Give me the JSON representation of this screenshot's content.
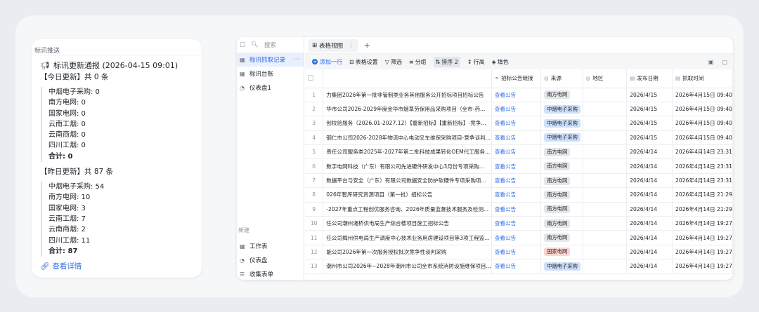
{
  "notify": {
    "header": "标讯推送",
    "title": "标讯更新通报 (2026-04-15 09:01)",
    "today_heading": "【今日更新】共 0 条",
    "today_lines": [
      "中烟电子采购: 0",
      "南方电网: 0",
      "国家电网: 0",
      "云南工烟: 0",
      "云南商烟: 0",
      "四川工烟: 0"
    ],
    "today_total": "合计: 0",
    "yesterday_heading": "【昨日更新】共 87 条",
    "yesterday_lines": [
      "中烟电子采购: 54",
      "南方电网: 10",
      "国家电网: 3",
      "云南工烟: 7",
      "云南商烟: 2",
      "四川工烟: 11"
    ],
    "yesterday_total": "合计: 87",
    "link_label": "查看详情",
    "link_color": "#2e6be6"
  },
  "app": {
    "search_label": "搜索",
    "sidebar_items": [
      {
        "label": "标讯抓取记录",
        "active": true
      },
      {
        "label": "标讯台账",
        "active": false
      },
      {
        "label": "仪表盘1",
        "active": false
      }
    ],
    "new_label": "新建",
    "new_items": [
      "工作表",
      "仪表盘",
      "收集表单"
    ],
    "view_tab": "表格视图",
    "toolbar": {
      "add_row": "添加一行",
      "table_settings": "表格设置",
      "filter": "筛选",
      "group": "分组",
      "sort": "排序 2",
      "row_height": "行高",
      "fill_color": "填色"
    },
    "columns": [
      "",
      "招标公告链接",
      "来源",
      "地区",
      "发布日期",
      "抓取时间"
    ],
    "rows": [
      {
        "n": "1",
        "title": "力集团2026年第一批非管制类业务其他服务公开招标项目招标公告",
        "link": "查看公告",
        "source": "南方电网",
        "tag": "gray",
        "date": "2026/4/15",
        "fetched": "2026年4月15日 09:40"
      },
      {
        "n": "2",
        "title": "华市公司2026-2029年度金华市烟草劳保用品采购项目（全市-药...",
        "link": "查看公告",
        "source": "中烟电子采购",
        "tag": "blue",
        "date": "2026/4/15",
        "fetched": "2026年4月15日 09:40"
      },
      {
        "n": "3",
        "title": "创校验服务（2026.01-2027.12）【重新招标】【重新招标】-竞争...",
        "link": "查看公告",
        "source": "中烟电子采购",
        "tag": "blue",
        "date": "2026/4/15",
        "fetched": "2026年4月15日 09:40"
      },
      {
        "n": "4",
        "title": "钢仁市公司2026-2028年物流中心电动叉车维保采购项目-竞争谈判...",
        "link": "查看公告",
        "source": "中烟电子采购",
        "tag": "blue",
        "date": "2026/4/15",
        "fetched": "2026年4月15日 09:40"
      },
      {
        "n": "5",
        "title": "责任公司服务类2025年-2027年第二批科技成果转化OEM代工服务...",
        "link": "查看公告",
        "source": "南方电网",
        "tag": "gray",
        "date": "2026/4/14",
        "fetched": "2026年4月14日 23:31"
      },
      {
        "n": "6",
        "title": "数字电网科技（广东）有限公司先进硬件研发中心3月份专项采购...",
        "link": "查看公告",
        "source": "南方电网",
        "tag": "gray",
        "date": "2026/4/14",
        "fetched": "2026年4月14日 23:31"
      },
      {
        "n": "7",
        "title": "数据平台与安全（广东）有限公司数据安全防护软硬件专项采购项...",
        "link": "查看公告",
        "source": "南方电网",
        "tag": "gray",
        "date": "2026/4/14",
        "fetched": "2026年4月14日 23:31"
      },
      {
        "n": "8",
        "title": "026年智库研究资源项目（第一批）招标公告",
        "link": "查看公告",
        "source": "南方电网",
        "tag": "gray",
        "date": "2026/4/14",
        "fetched": "2026年4月14日 21:29"
      },
      {
        "n": "9",
        "title": "-2027年重点工程创优服务咨询、2026年质量监督技术服务及检测...",
        "link": "查看公告",
        "source": "南方电网",
        "tag": "gray",
        "date": "2026/4/14",
        "fetched": "2026年4月14日 21:29"
      },
      {
        "n": "10",
        "title": "任公司潮州湘桥供电局生产综合楼项目施工招标公告",
        "link": "查看公告",
        "source": "南方电网",
        "tag": "gray",
        "date": "2026/4/14",
        "fetched": "2026年4月14日 19:27"
      },
      {
        "n": "11",
        "title": "任公司梅州供电局生产调度中心技术业务用房建设项目等3项工程监...",
        "link": "查看公告",
        "source": "南方电网",
        "tag": "gray",
        "date": "2026/4/14",
        "fetched": "2026年4月14日 19:27"
      },
      {
        "n": "12",
        "title": "能公司2026年第一次服务授权批次竞争性谈判采购",
        "link": "查看公告",
        "source": "国家电网",
        "tag": "red",
        "date": "2026/4/14",
        "fetched": "2026年4月14日 19:27"
      },
      {
        "n": "13",
        "title": "潮州市公司2026年~2028年潮州市公司全市系统消防设施维保项目...",
        "link": "查看公告",
        "source": "中烟电子采购",
        "tag": "blue",
        "date": "2026/4/14",
        "fetched": "2026年4月14日 19:27"
      }
    ]
  }
}
